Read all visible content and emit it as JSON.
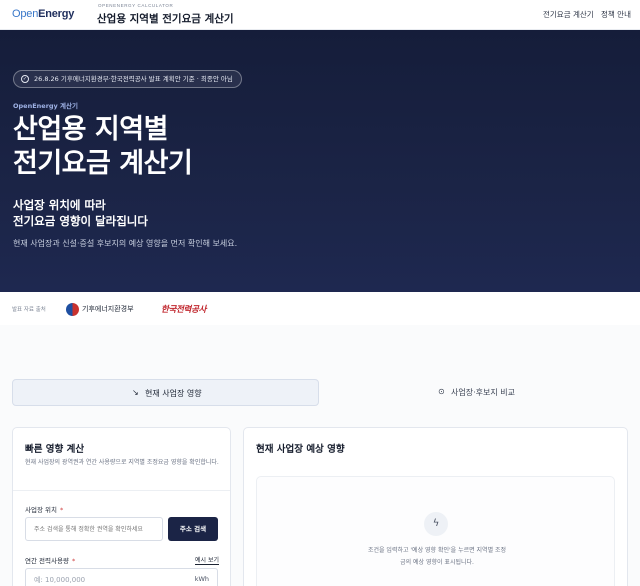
{
  "header": {
    "logo_open": "Open",
    "logo_energy": "Energy",
    "brand_sub": "OPENENERGY CALCULATOR",
    "brand_title": "산업용 지역별 전기요금 계산기",
    "nav": [
      "전기요금 계산기",
      "정책 안내"
    ]
  },
  "hero": {
    "pill": "26.8.26 기후에너지환경부·한국전력공사 발표 계획안 기준 · 최종안 아님",
    "eyebrow": "OpenEnergy 계산기",
    "title_line1": "산업용 지역별",
    "title_line2": "전기요금 계산기",
    "sub_line1": "사업장 위치에 따라",
    "sub_line2": "전기요금 영향이 달라집니다",
    "lead": "현재 사업장과 신설·증설 후보지의 예상 영향을 먼저 확인해 보세요."
  },
  "sources": {
    "label": "발표 자료 출처",
    "gov": "기후에너지환경부",
    "kepco": "한국전력공사"
  },
  "tabs": {
    "current": "현재 사업장 영향",
    "compare": "사업장·후보지 비교"
  },
  "quick": {
    "title": "빠른 영향 계산",
    "desc": "현재 사업장의 광역권과 연간 사용량으로 지역별 조정요금 영향을 확인합니다.",
    "location_label": "사업장 위치",
    "required": "*",
    "address_placeholder": "주소 검색을 통해 정확한 권역을 확인하세요",
    "address_button": "주소 검색",
    "usage_label": "연간 전력사용량",
    "example_link": "예시 보기",
    "usage_placeholder": "예: 10,000,000",
    "usage_unit": "kWh"
  },
  "result": {
    "title": "현재 사업장 예상 영향",
    "empty_line1": "조건을 입력하고 '예상 영향 확인'을 누르면 지역별 조정",
    "empty_line2": "금의 예상 영향이 표시됩니다."
  },
  "icons": {
    "pill": "shield-check-icon",
    "tab_current": "trend-icon",
    "tab_compare": "location-pin-icon",
    "empty": "lightning-icon"
  }
}
